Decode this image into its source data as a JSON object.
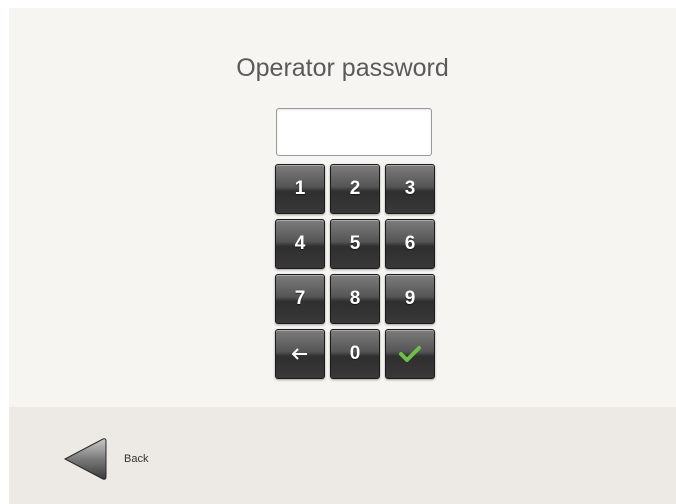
{
  "screen": {
    "title": "Operator password"
  },
  "password_field": {
    "value": ""
  },
  "keypad": {
    "keys": [
      "1",
      "2",
      "3",
      "4",
      "5",
      "6",
      "7",
      "8",
      "9",
      "0"
    ],
    "backspace_icon": "left-arrow-icon",
    "confirm_icon": "checkmark-icon",
    "confirm_color": "#6cc04a"
  },
  "footer": {
    "back_label": "Back",
    "back_icon": "left-triangle-icon"
  },
  "colors": {
    "background": "#f6f5f1",
    "footer_background": "#edeae5",
    "key_background": "#444444",
    "title_text": "#5a5a5a"
  }
}
